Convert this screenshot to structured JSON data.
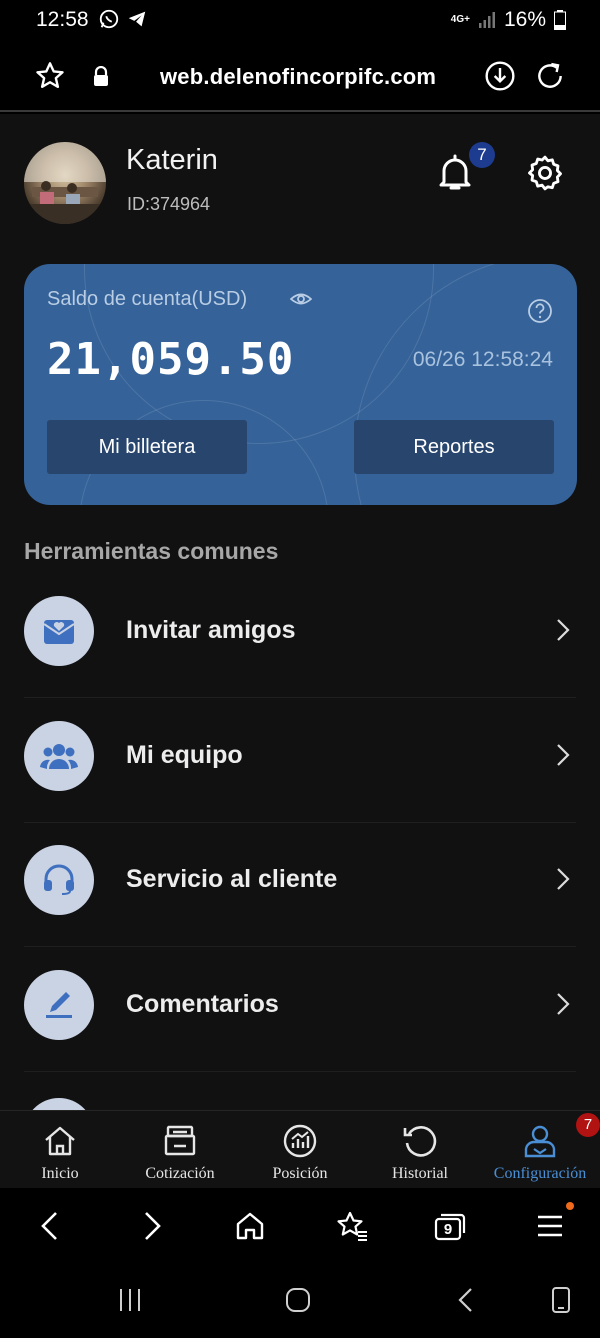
{
  "status_bar": {
    "time": "12:58",
    "network": "4G+",
    "battery": "16%"
  },
  "browser": {
    "url": "web.delenofincorpifc.com",
    "tab_count": "9"
  },
  "profile": {
    "name": "Katerin",
    "id_text": "ID:374964",
    "notification_count": "7"
  },
  "balance_card": {
    "label": "Saldo de cuenta(USD)",
    "amount": "21,059.50",
    "timestamp": "06/26 12:58:24",
    "wallet_button": "Mi billetera",
    "reports_button": "Reportes",
    "color": "#346299"
  },
  "tools": {
    "title": "Herramientas comunes",
    "items": [
      {
        "label": "Invitar amigos",
        "icon": "invite-mail-heart-icon"
      },
      {
        "label": "Mi equipo",
        "icon": "team-group-icon"
      },
      {
        "label": "Servicio al cliente",
        "icon": "headset-icon"
      },
      {
        "label": "Comentarios",
        "icon": "pen-edit-icon"
      }
    ]
  },
  "app_nav": {
    "items": [
      {
        "label": "Inicio",
        "icon": "home-icon"
      },
      {
        "label": "Cotización",
        "icon": "quote-register-icon"
      },
      {
        "label": "Posición",
        "icon": "position-chart-icon"
      },
      {
        "label": "Historial",
        "icon": "history-icon"
      },
      {
        "label": "Configuración",
        "icon": "user-config-icon",
        "active": true,
        "badge": "7"
      }
    ],
    "active_color": "#4a8fd6"
  }
}
